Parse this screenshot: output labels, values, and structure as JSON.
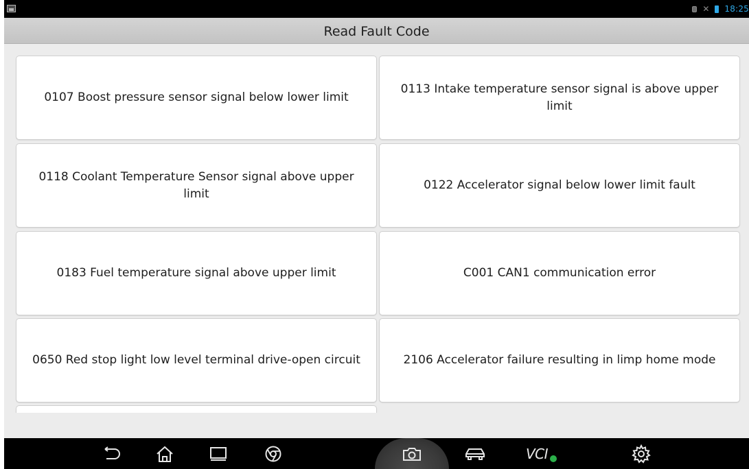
{
  "status_bar": {
    "time": "18:25",
    "icons": [
      "gallery-icon",
      "lock-icon",
      "mute-icon",
      "battery-icon"
    ]
  },
  "header": {
    "title": "Read Fault Code"
  },
  "fault_codes": [
    "0107 Boost pressure sensor signal below lower limit",
    "0113 Intake temperature sensor signal is above upper limit",
    "0118 Coolant Temperature Sensor signal above upper limit",
    "0122 Accelerator signal below lower limit fault",
    "0183 Fuel temperature signal above upper limit",
    "C001 CAN1 communication error",
    "0650 Red stop light low level terminal drive-open circuit",
    "2106 Accelerator failure resulting in limp home mode"
  ],
  "nav_bar": {
    "items": [
      "back-icon",
      "home-icon",
      "recent-apps-icon",
      "browser-icon",
      "camera-icon",
      "vehicle-icon",
      "vci-icon",
      "settings-icon"
    ],
    "vci_label": "VCI"
  },
  "colors": {
    "status_accent": "#2fa8e6",
    "title_bar": "#c8c8c8",
    "background": "#ececec",
    "card": "#ffffff",
    "nav_bar": "#000000",
    "vci_status": "#2bb04a"
  }
}
